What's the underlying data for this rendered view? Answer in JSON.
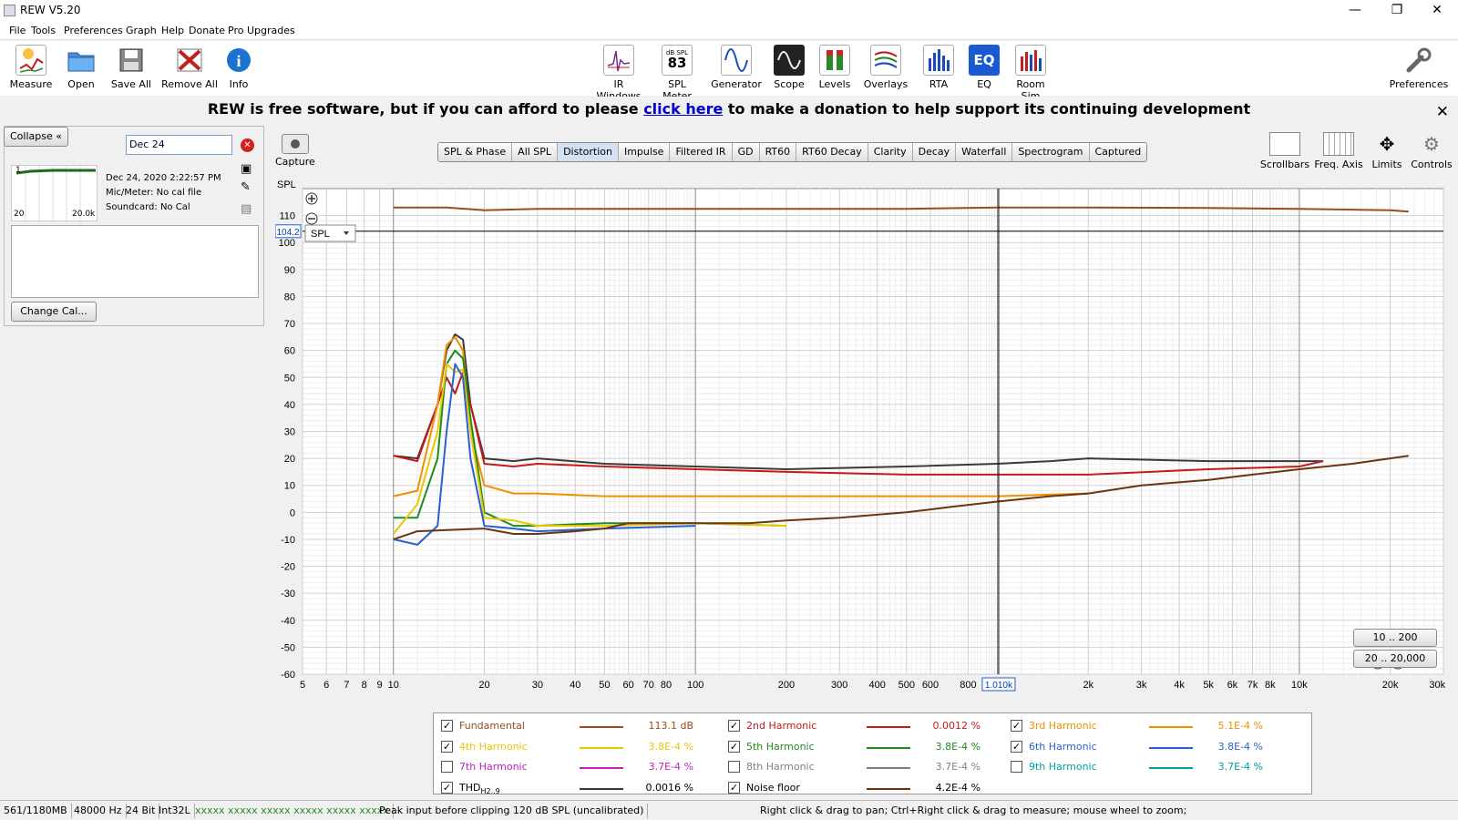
{
  "window": {
    "title": "REW V5.20"
  },
  "menu": [
    "File",
    "Tools",
    "Preferences",
    "Graph",
    "Help",
    "Donate",
    "Pro Upgrades"
  ],
  "toolbar": {
    "left": [
      {
        "label": "Measure",
        "icon": "measure-icon",
        "color": "#f6c244"
      },
      {
        "label": "Open",
        "icon": "folder-icon",
        "color": "#4a90d9"
      },
      {
        "label": "Save All",
        "icon": "save-icon",
        "color": "#888888"
      },
      {
        "label": "Remove All",
        "icon": "remove-all-icon",
        "color": "#c02020"
      },
      {
        "label": "Info",
        "icon": "info-icon",
        "color": "#1a73d0"
      }
    ],
    "center": [
      {
        "label": "IR Windows",
        "icon": "ir-windows-icon",
        "glyph": "∿"
      },
      {
        "label": "SPL Meter",
        "icon": "spl-meter-icon",
        "glyph": "83",
        "sub": "dB SPL"
      },
      {
        "label": "Generator",
        "icon": "generator-icon",
        "glyph": "∿"
      },
      {
        "label": "Scope",
        "icon": "scope-icon",
        "glyph": "∿"
      },
      {
        "label": "Levels",
        "icon": "levels-icon",
        "glyph": "▮▮"
      },
      {
        "label": "Overlays",
        "icon": "overlays-icon",
        "glyph": "≋"
      },
      {
        "label": "RTA",
        "icon": "rta-icon",
        "glyph": "▮▮▮"
      },
      {
        "label": "EQ",
        "icon": "eq-icon",
        "glyph": "EQ"
      },
      {
        "label": "Room Sim",
        "icon": "room-sim-icon",
        "glyph": "▮▮▮"
      }
    ],
    "preferences": "Preferences"
  },
  "donate": {
    "prefix": "REW is free software, but if you can afford to please ",
    "link": "click here",
    "suffix": " to make a donation to help support its continuing development"
  },
  "leftpanel": {
    "collapse": "Collapse",
    "name_value": "Dec 24",
    "thumb_min": "20",
    "thumb_max": "20.0k",
    "thumb_marker": "1",
    "info": [
      "Dec 24, 2020 2:22:57 PM",
      "Mic/Meter: No cal file",
      "Soundcard: No Cal"
    ],
    "change_cal": "Change Cal..."
  },
  "capture": "Capture",
  "tabs": [
    "SPL & Phase",
    "All SPL",
    "Distortion",
    "Impulse",
    "Filtered IR",
    "GD",
    "RT60",
    "RT60 Decay",
    "Clarity",
    "Decay",
    "Waterfall",
    "Spectrogram",
    "Captured"
  ],
  "active_tab": "Distortion",
  "right_tools": [
    "Scrollbars",
    "Freq. Axis",
    "Limits",
    "Controls"
  ],
  "graph": {
    "y_label": "SPL",
    "cursor_y": "104.2",
    "cursor_x": "1.010k",
    "unit_select": "SPL",
    "zoom_buttons": [
      "10 .. 200",
      "20 .. 20,000"
    ]
  },
  "chart_data": {
    "type": "line",
    "xlabel": "",
    "ylabel": "SPL",
    "x_scale": "log",
    "xlim": [
      5,
      30000
    ],
    "ylim": [
      -60,
      120
    ],
    "x_ticks": [
      {
        "v": 5,
        "t": "5"
      },
      {
        "v": 6,
        "t": "6"
      },
      {
        "v": 7,
        "t": "7"
      },
      {
        "v": 8,
        "t": "8"
      },
      {
        "v": 9,
        "t": "9"
      },
      {
        "v": 10,
        "t": "10"
      },
      {
        "v": 20,
        "t": "20"
      },
      {
        "v": 30,
        "t": "30"
      },
      {
        "v": 40,
        "t": "40"
      },
      {
        "v": 50,
        "t": "50"
      },
      {
        "v": 60,
        "t": "60"
      },
      {
        "v": 70,
        "t": "70"
      },
      {
        "v": 80,
        "t": "80"
      },
      {
        "v": 100,
        "t": "100"
      },
      {
        "v": 200,
        "t": "200"
      },
      {
        "v": 300,
        "t": "300"
      },
      {
        "v": 400,
        "t": "400"
      },
      {
        "v": 500,
        "t": "500"
      },
      {
        "v": 600,
        "t": "600"
      },
      {
        "v": 800,
        "t": "800"
      },
      {
        "v": 2000,
        "t": "2k"
      },
      {
        "v": 3000,
        "t": "3k"
      },
      {
        "v": 4000,
        "t": "4k"
      },
      {
        "v": 5000,
        "t": "5k"
      },
      {
        "v": 6000,
        "t": "6k"
      },
      {
        "v": 7000,
        "t": "7k"
      },
      {
        "v": 8000,
        "t": "8k"
      },
      {
        "v": 10000,
        "t": "10k"
      },
      {
        "v": 20000,
        "t": "20k"
      },
      {
        "v": 30000,
        "t": "30kHz"
      }
    ],
    "y_ticks": [
      110,
      100,
      90,
      80,
      70,
      60,
      50,
      40,
      30,
      20,
      10,
      0,
      -10,
      -20,
      -30,
      -40,
      -50,
      -60
    ],
    "cursor": {
      "x": 1010,
      "y": 104.2
    },
    "series": [
      {
        "name": "Fundamental",
        "color": "#9c4a1e",
        "x": [
          10,
          15,
          20,
          30,
          50,
          100,
          200,
          500,
          1000,
          2000,
          5000,
          10000,
          20000,
          23000
        ],
        "y": [
          113,
          113,
          112,
          112.5,
          112.5,
          112.5,
          112.5,
          112.5,
          113,
          113,
          112.8,
          112.5,
          112,
          111.5
        ]
      },
      {
        "name": "THD",
        "color": "#3a3a3a",
        "x": [
          10,
          12,
          14,
          15,
          16,
          17,
          18,
          20,
          25,
          30,
          50,
          100,
          200,
          500,
          1000,
          1500,
          2000,
          5000,
          10000,
          12000
        ],
        "y": [
          21,
          20,
          40,
          60,
          66,
          64,
          40,
          20,
          19,
          20,
          18,
          17,
          16,
          17,
          18,
          19,
          20,
          19,
          19,
          19
        ]
      },
      {
        "name": "2nd Harmonic",
        "color": "#c81818",
        "x": [
          10,
          12,
          14,
          15,
          16,
          17,
          18,
          20,
          25,
          30,
          50,
          100,
          200,
          500,
          1000,
          1500,
          2000,
          5000,
          10000,
          12000
        ],
        "y": [
          21,
          19,
          40,
          50,
          44,
          52,
          40,
          18,
          17,
          18,
          17,
          16,
          15,
          14,
          14,
          14,
          14,
          16,
          17,
          19
        ]
      },
      {
        "name": "3rd Harmonic",
        "color": "#f09000",
        "x": [
          10,
          12,
          14,
          15,
          16,
          17,
          18,
          20,
          25,
          30,
          50,
          100,
          200,
          500,
          1000,
          2000
        ],
        "y": [
          6,
          8,
          40,
          62,
          65,
          60,
          30,
          10,
          7,
          7,
          6,
          6,
          6,
          6,
          6,
          7
        ]
      },
      {
        "name": "5th Harmonic",
        "color": "#1e8a1e",
        "x": [
          10,
          12,
          14,
          15,
          16,
          17,
          18,
          20,
          25,
          30,
          50,
          100,
          200
        ],
        "y": [
          -2,
          -2,
          20,
          55,
          60,
          57,
          35,
          0,
          -5,
          -5,
          -4,
          -4,
          -5
        ]
      },
      {
        "name": "4th Harmonic",
        "color": "#e8c800",
        "x": [
          10,
          12,
          14,
          15,
          16,
          17,
          18,
          20,
          25,
          30,
          50,
          100,
          200
        ],
        "y": [
          -8,
          3,
          30,
          55,
          52,
          53,
          30,
          -2,
          -3,
          -5,
          -5,
          -4,
          -5
        ]
      },
      {
        "name": "6th Harmonic",
        "color": "#2a5fd4",
        "x": [
          10,
          12,
          14,
          15,
          16,
          17,
          18,
          20,
          25,
          30,
          50,
          100
        ],
        "y": [
          -10,
          -12,
          -5,
          30,
          55,
          50,
          20,
          -5,
          -6,
          -7,
          -6,
          -5
        ]
      },
      {
        "name": "Noise floor",
        "color": "#6b3510",
        "x": [
          10,
          12,
          20,
          25,
          30,
          40,
          50,
          60,
          100,
          150,
          200,
          300,
          500,
          700,
          1000,
          1500,
          2000,
          3000,
          5000,
          7000,
          10000,
          15000,
          20000,
          23000
        ],
        "y": [
          -10,
          -7,
          -6,
          -8,
          -8,
          -7,
          -6,
          -4,
          -4,
          -4,
          -3,
          -2,
          0,
          2,
          4,
          6,
          7,
          10,
          12,
          14,
          16,
          18,
          20,
          21
        ]
      }
    ]
  },
  "legend": [
    {
      "name": "Fundamental",
      "checked": true,
      "color": "#9c4a1e",
      "value": "113.1 dB"
    },
    {
      "name": "2nd Harmonic",
      "checked": true,
      "color": "#c81818",
      "value": "0.0012 %"
    },
    {
      "name": "3rd Harmonic",
      "checked": true,
      "color": "#f09000",
      "value": "5.1E-4 %"
    },
    {
      "name": "4th Harmonic",
      "checked": true,
      "color": "#e8c800",
      "value": "3.8E-4 %"
    },
    {
      "name": "5th Harmonic",
      "checked": true,
      "color": "#1e8a1e",
      "value": "3.8E-4 %"
    },
    {
      "name": "6th Harmonic",
      "checked": true,
      "color": "#2a5fd4",
      "value": "3.8E-4 %"
    },
    {
      "name": "7th Harmonic",
      "checked": false,
      "color": "#c020c0",
      "value": "3.7E-4 %"
    },
    {
      "name": "8th Harmonic",
      "checked": false,
      "color": "#808080",
      "value": "3.7E-4 %"
    },
    {
      "name": "9th Harmonic",
      "checked": false,
      "color": "#00a0a0",
      "value": "3.7E-4 %"
    },
    {
      "name": "THD",
      "sub": "H2..9",
      "checked": true,
      "color": "#3a3a3a",
      "value": "0.0016 %"
    },
    {
      "name": "Noise floor",
      "checked": true,
      "color": "#6b3510",
      "value": "4.2E-4 %"
    }
  ],
  "status": {
    "memory": "561/1180MB",
    "rate": "48000 Hz",
    "bits": "24 Bit",
    "format": "Int32L",
    "meters": "xxxxx xxxxx   xxxxx xxxxx   xxxxx xxxxx",
    "peak": "Peak input before clipping 120 dB SPL (uncalibrated)",
    "hint": "Right click & drag to pan; Ctrl+Right click & drag to measure; mouse wheel to zoom;"
  }
}
